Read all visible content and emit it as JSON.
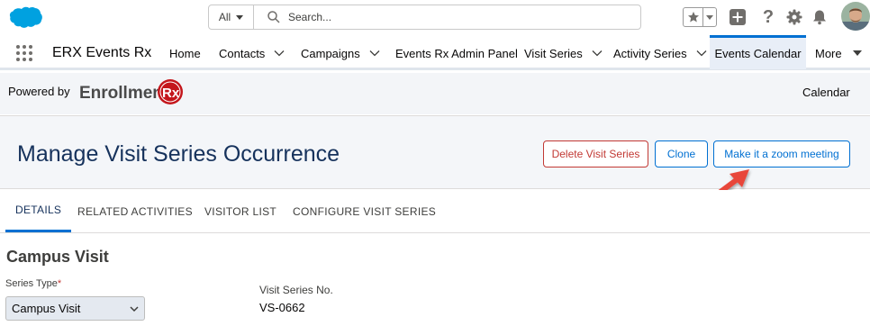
{
  "header": {
    "search_scope": "All",
    "search_placeholder": "Search..."
  },
  "nav": {
    "app_name": "ERX Events Rx",
    "items": [
      {
        "label": "Home"
      },
      {
        "label": "Contacts"
      },
      {
        "label": "Campaigns"
      },
      {
        "label": "Events Rx Admin Panel"
      },
      {
        "label": "Visit Series"
      },
      {
        "label": "Activity Series"
      },
      {
        "label": "Events Calendar"
      },
      {
        "label": "More"
      }
    ]
  },
  "powered": {
    "text": "Powered by",
    "brand": "EnrollmentRx",
    "calendar_link": "Calendar"
  },
  "page": {
    "title": "Manage Visit Series Occurrence",
    "buttons": {
      "delete": "Delete Visit Series",
      "clone": "Clone",
      "zoom": "Make it a zoom meeting"
    }
  },
  "tabs": [
    {
      "label": "DETAILS"
    },
    {
      "label": "RELATED ACTIVITIES"
    },
    {
      "label": "VISITOR LIST"
    },
    {
      "label": "CONFIGURE VISIT SERIES"
    }
  ],
  "content": {
    "section_title": "Campus Visit",
    "series_type_label": "Series Type",
    "series_type_value": "Campus Visit",
    "visit_series_no_label": "Visit Series No.",
    "visit_series_no_value": "VS-0662"
  },
  "colors": {
    "brand_blue": "#0070d2",
    "danger_red": "#c23934",
    "salesforce_cloud": "#00a1e0",
    "annotation_arrow": "#e8473b"
  }
}
